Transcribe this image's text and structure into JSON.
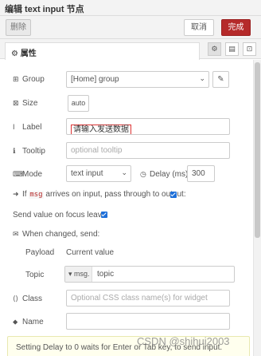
{
  "window": {
    "title": "编辑 text input 节点"
  },
  "toolbar": {
    "delete_label": "删除",
    "cancel_label": "取消",
    "done_label": "完成"
  },
  "tabs": {
    "properties_label": "属性"
  },
  "form": {
    "group": {
      "label": "Group",
      "value": "[Home] group"
    },
    "size": {
      "label": "Size",
      "value": "auto"
    },
    "label": {
      "label": "Label",
      "value": "请输入发送数据"
    },
    "tooltip": {
      "label": "Tooltip",
      "placeholder": "optional tooltip"
    },
    "mode": {
      "label": "Mode",
      "value": "text input"
    },
    "delay": {
      "label": "Delay (ms)",
      "value": "300"
    },
    "passthrough": {
      "prefix": "If",
      "code": "msg",
      "suffix": "arrives on input, pass through to output:",
      "checked": true
    },
    "send_on_focus": {
      "label": "Send value on focus leave:",
      "checked": true
    },
    "when_changed": {
      "label": "When changed, send:"
    },
    "payload": {
      "label": "Payload",
      "value": "Current value"
    },
    "topic": {
      "label": "Topic",
      "type": "msg.",
      "value": "topic"
    },
    "class": {
      "label": "Class",
      "placeholder": "Optional CSS class name(s) for widget"
    },
    "name": {
      "label": "Name",
      "value": ""
    }
  },
  "tip": {
    "text": "Setting Delay to 0 waits for Enter or Tab key, to send input."
  },
  "watermark": {
    "text": "CSDN @shihui2003"
  },
  "colors": {
    "accent": "#b52a2a",
    "checkbox": "#1e6fd9",
    "tip_bg": "#ffffee"
  }
}
